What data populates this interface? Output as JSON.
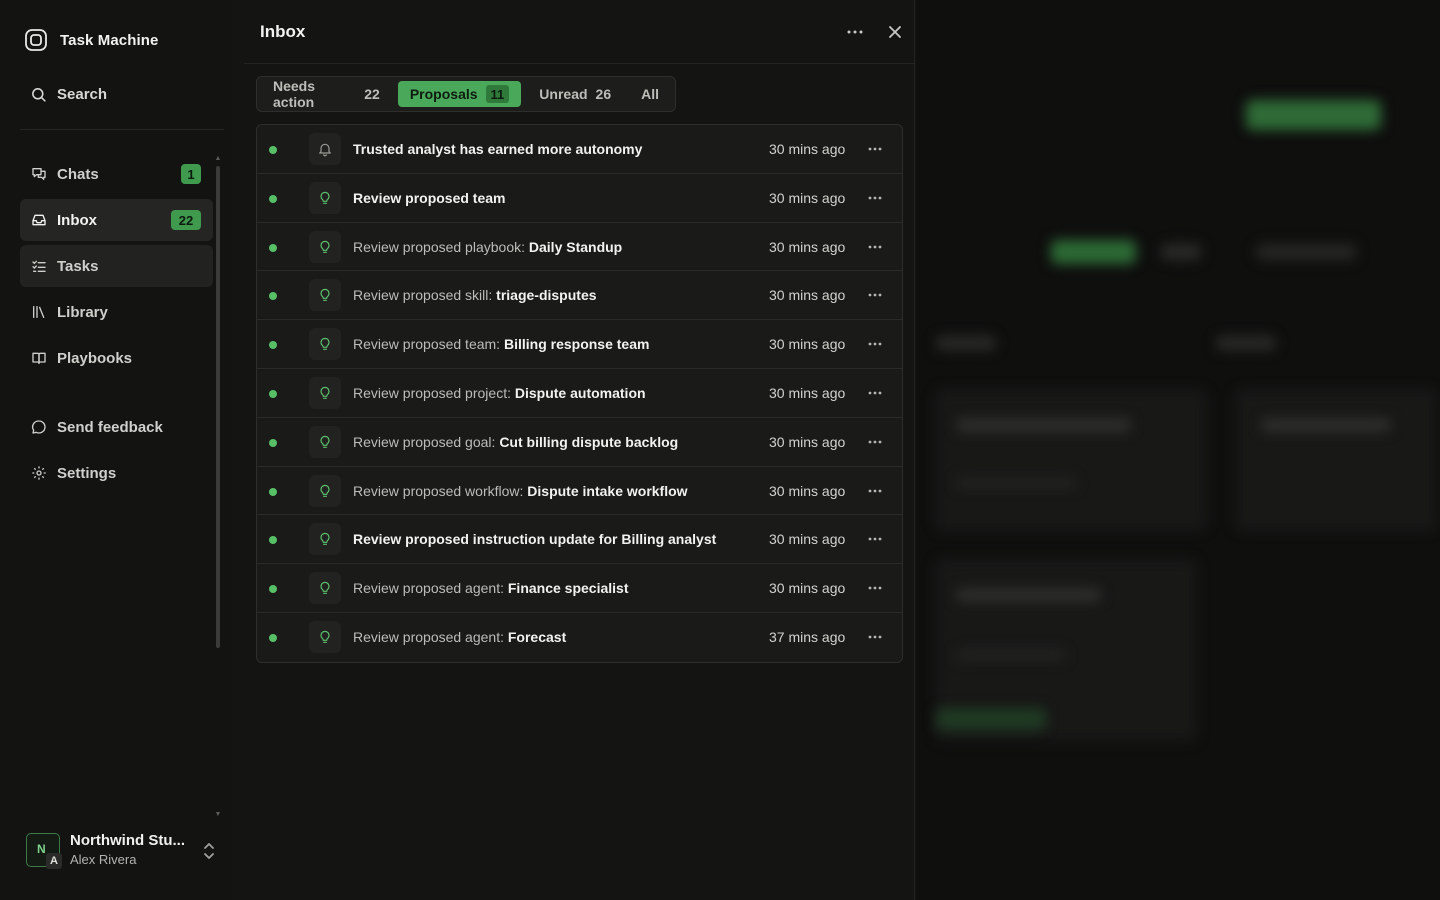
{
  "app": {
    "name": "Task Machine"
  },
  "sidebar": {
    "search_label": "Search",
    "items": [
      {
        "label": "Chats",
        "badge": "1",
        "icon": "chats-icon"
      },
      {
        "label": "Inbox",
        "badge": "22",
        "icon": "inbox-icon"
      },
      {
        "label": "Tasks",
        "badge": null,
        "icon": "tasks-icon"
      },
      {
        "label": "Library",
        "badge": null,
        "icon": "library-icon"
      },
      {
        "label": "Playbooks",
        "badge": null,
        "icon": "playbooks-icon"
      }
    ],
    "secondary": [
      {
        "label": "Send feedback",
        "icon": "feedback-icon"
      },
      {
        "label": "Settings",
        "icon": "gear-icon"
      }
    ],
    "account": {
      "org": "Northwind Stu...",
      "user": "Alex Rivera",
      "avatar_letter": "N",
      "avatar_sub": "A"
    }
  },
  "inbox": {
    "title": "Inbox",
    "tabs": [
      {
        "label": "Needs action",
        "count": "22",
        "active": false
      },
      {
        "label": "Proposals",
        "count": "11",
        "active": true
      },
      {
        "label": "Unread",
        "count": "26",
        "active": false
      },
      {
        "label": "All",
        "count": "",
        "active": false
      }
    ],
    "rows": [
      {
        "prefix": "",
        "bold": "Trusted analyst has earned more autonomy",
        "time": "30 mins ago",
        "icon": "bell-icon"
      },
      {
        "prefix": "",
        "bold": "Review proposed team",
        "time": "30 mins ago",
        "icon": "lightbulb-icon"
      },
      {
        "prefix": "Review proposed playbook: ",
        "bold": "Daily Standup",
        "time": "30 mins ago",
        "icon": "lightbulb-icon"
      },
      {
        "prefix": "Review proposed skill: ",
        "bold": "triage-disputes",
        "time": "30 mins ago",
        "icon": "lightbulb-icon"
      },
      {
        "prefix": "Review proposed team: ",
        "bold": "Billing response team",
        "time": "30 mins ago",
        "icon": "lightbulb-icon"
      },
      {
        "prefix": "Review proposed project: ",
        "bold": "Dispute automation",
        "time": "30 mins ago",
        "icon": "lightbulb-icon"
      },
      {
        "prefix": "Review proposed goal: ",
        "bold": "Cut billing dispute backlog",
        "time": "30 mins ago",
        "icon": "lightbulb-icon"
      },
      {
        "prefix": "Review proposed workflow: ",
        "bold": "Dispute intake workflow",
        "time": "30 mins ago",
        "icon": "lightbulb-icon"
      },
      {
        "prefix": "",
        "bold": "Review proposed instruction update for Billing analyst",
        "time": "30 mins ago",
        "icon": "lightbulb-icon"
      },
      {
        "prefix": "Review proposed agent: ",
        "bold": "Finance specialist",
        "time": "30 mins ago",
        "icon": "lightbulb-icon"
      },
      {
        "prefix": "Review proposed agent: ",
        "bold": "Forecast",
        "time": "37 mins ago",
        "icon": "lightbulb-icon"
      }
    ]
  },
  "colors": {
    "accent": "#4aa85a",
    "unread_dot": "#57c067",
    "badge": "#3f9a4e"
  }
}
